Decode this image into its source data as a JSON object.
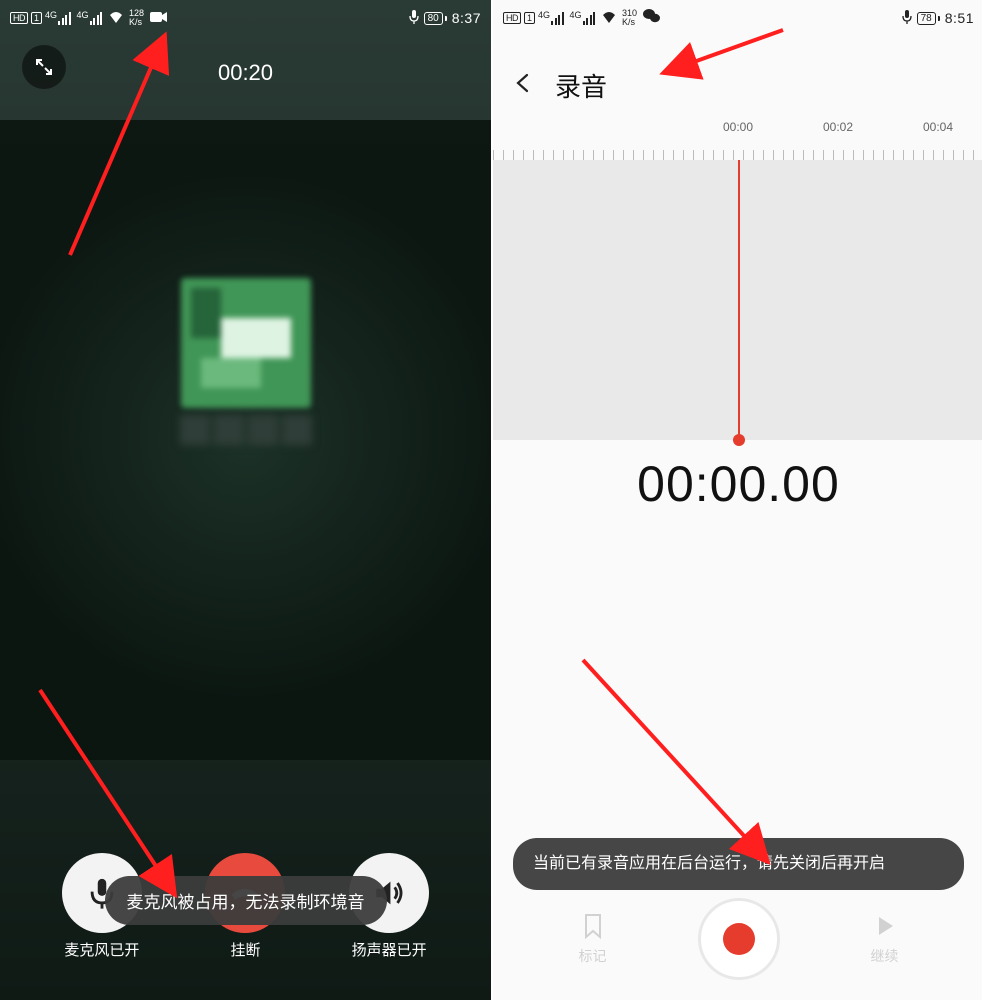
{
  "left": {
    "status": {
      "hd": "HD",
      "sim": "1",
      "net_speed": "128",
      "net_unit": "K/s",
      "net_4g": "4G",
      "battery": "80",
      "time": "8:37"
    },
    "call_timer": "00:20",
    "controls": {
      "mute": "麦克风已开",
      "hangup": "挂断",
      "speaker": "扬声器已开"
    },
    "toast": "麦克风被占用，无法录制环境音"
  },
  "right": {
    "status": {
      "hd": "HD",
      "sim": "1",
      "net_speed": "310",
      "net_unit": "K/s",
      "net_4g": "4G",
      "battery": "78",
      "time": "8:51"
    },
    "title": "录音",
    "ruler": {
      "t0": "00:00",
      "t1": "00:02",
      "t2": "00:04"
    },
    "timer": "00:00.00",
    "controls": {
      "mark": "标记",
      "continue": "继续"
    },
    "toast": "当前已有录音应用在后台运行，请先关闭后再开启"
  }
}
